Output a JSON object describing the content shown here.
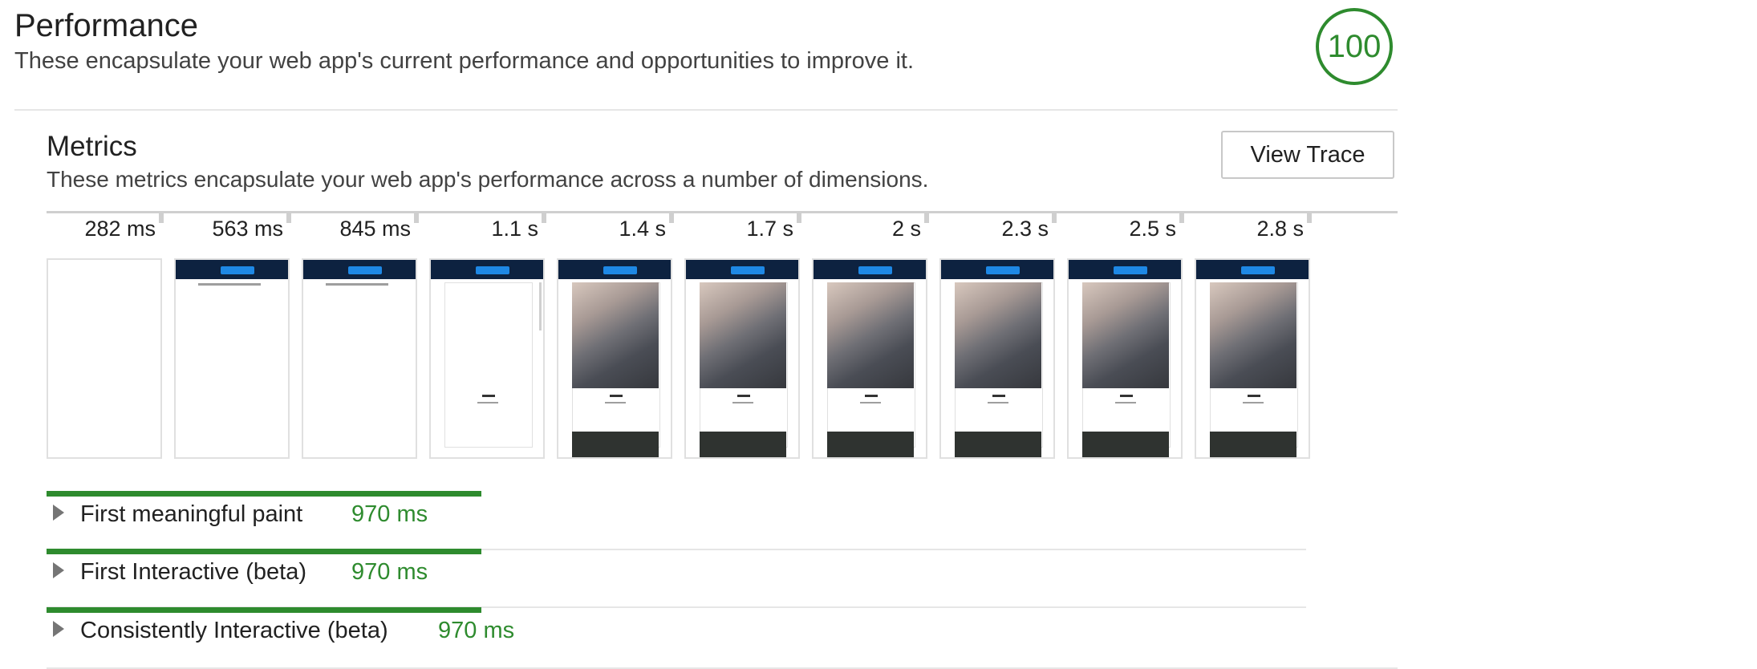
{
  "performance": {
    "title": "Performance",
    "description": "These encapsulate your web app's current performance and opportunities to improve it.",
    "score": "100",
    "score_color": "#2e8b2e"
  },
  "metrics": {
    "title": "Metrics",
    "description": "These metrics encapsulate your web app's performance across a number of dimensions.",
    "view_trace_label": "View Trace"
  },
  "filmstrip": {
    "frames": [
      {
        "label": "282 ms",
        "state": "blank"
      },
      {
        "label": "563 ms",
        "state": "header-text"
      },
      {
        "label": "845 ms",
        "state": "header-text"
      },
      {
        "label": "1.1 s",
        "state": "card-no-image"
      },
      {
        "label": "1.4 s",
        "state": "card-image"
      },
      {
        "label": "1.7 s",
        "state": "card-image"
      },
      {
        "label": "2 s",
        "state": "card-image"
      },
      {
        "label": "2.3 s",
        "state": "card-image"
      },
      {
        "label": "2.5 s",
        "state": "card-image"
      },
      {
        "label": "2.8 s",
        "state": "card-image"
      }
    ]
  },
  "metric_rows": [
    {
      "label": "First meaningful paint",
      "value": "970 ms"
    },
    {
      "label": "First Interactive (beta)",
      "value": "970 ms"
    },
    {
      "label": "Consistently Interactive (beta)",
      "value": "970 ms"
    }
  ],
  "colors": {
    "pass_green": "#2e8b2e",
    "thumbnail_header": "#0d2240",
    "thumbnail_button": "#1e88e5"
  }
}
